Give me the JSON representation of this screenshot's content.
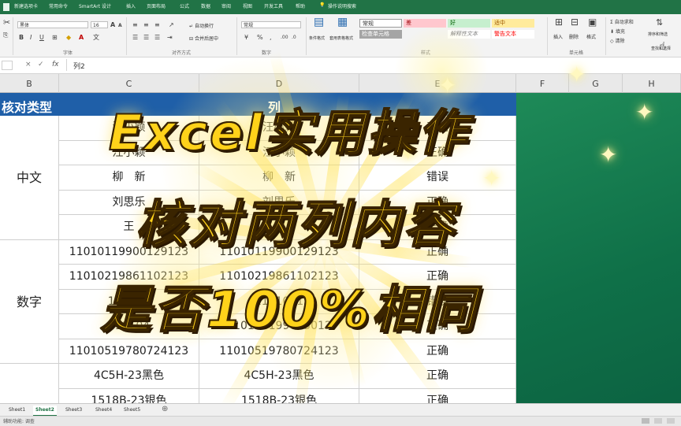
{
  "ribbon_tabs": [
    "新建选项卡",
    "常用命令",
    "SmartArt 设计",
    "插入",
    "页面布局",
    "公式",
    "数据",
    "审阅",
    "视图",
    "开发工具",
    "帮助",
    "操作说明搜索"
  ],
  "ribbon": {
    "font_name": "黑体",
    "font_size": "16",
    "number_format": "常规",
    "wrap_text": "自动换行",
    "merge_center": "合并后居中",
    "cond_format": "条件格式",
    "table_format": "套用表格格式",
    "styles": [
      {
        "label": "常规",
        "bg": "#ffffff",
        "fg": "#333333"
      },
      {
        "label": "差",
        "bg": "#ffc7ce",
        "fg": "#9c0006"
      },
      {
        "label": "好",
        "bg": "#c6efce",
        "fg": "#006100"
      },
      {
        "label": "适中",
        "bg": "#ffeb9c",
        "fg": "#9c5700"
      },
      {
        "label": "检查单元格",
        "bg": "#a5a5a5",
        "fg": "#ffffff"
      },
      {
        "label": "解释性文本",
        "bg": "#ffffff",
        "fg": "#7f7f7f"
      },
      {
        "label": "警告文本",
        "bg": "#ffffff",
        "fg": "#ff0000"
      }
    ],
    "insert": "插入",
    "delete": "删除",
    "format": "格式",
    "autosum": "自动求和",
    "fill": "填充",
    "clear": "清除",
    "sort_filter": "排序和筛选",
    "find_select": "查找和选择",
    "groups": [
      "字体",
      "对齐方式",
      "数字",
      "样式",
      "单元格"
    ]
  },
  "formula_bar": {
    "content": "列2",
    "cancel": "×",
    "enter": "✓",
    "fx": "fx"
  },
  "columns": [
    "B",
    "C",
    "D",
    "E",
    "F",
    "G",
    "H"
  ],
  "header_row": {
    "b": "核对类型",
    "d": "列"
  },
  "groups": [
    {
      "label": "中文",
      "rows": [
        {
          "c": "汪小颖",
          "d": "汪小颖",
          "e": "正确"
        },
        {
          "c": "汪小颖",
          "d": "汪小颖",
          "e": "正确"
        },
        {
          "c": "柳　新",
          "d": "柳　新",
          "e": "错误"
        },
        {
          "c": "刘思乐",
          "d": "刘思乐",
          "e": "正确"
        },
        {
          "c": "王　",
          "d": "王　",
          "e": "正确"
        }
      ]
    },
    {
      "label": "数字",
      "rows": [
        {
          "c": "110101199001291​23",
          "d": "110101199001291​23",
          "e": "正确"
        },
        {
          "c": "110102198611021​23",
          "d": "110102198611021​23",
          "e": "正确"
        },
        {
          "c": "110103",
          "d": "1101031",
          "e": "错误"
        },
        {
          "c": "110104",
          "d": "110104199003012",
          "e": "正确"
        },
        {
          "c": "11010519780724123",
          "d": "11010519780724123",
          "e": "正确"
        }
      ]
    },
    {
      "label": "",
      "rows": [
        {
          "c": "4C5H-23黑色",
          "d": "4C5H-23黑色",
          "e": "正确"
        },
        {
          "c": "1518B-23银色",
          "d": "1518B-23银色",
          "e": "正确"
        }
      ]
    }
  ],
  "overlay_title": [
    "Excel实用操作",
    "核对两列内容",
    "是否100%相同"
  ],
  "sheets": [
    "Sheet1",
    "Sheet2",
    "Sheet3",
    "Sheet4",
    "Sheet5"
  ],
  "active_sheet": "Sheet2",
  "status": "辅助功能: 调查",
  "colors": {
    "excel_green": "#217346",
    "title_fill": "#ffd21a",
    "title_stroke": "#3a2400",
    "panel_green": "#137a4c"
  }
}
